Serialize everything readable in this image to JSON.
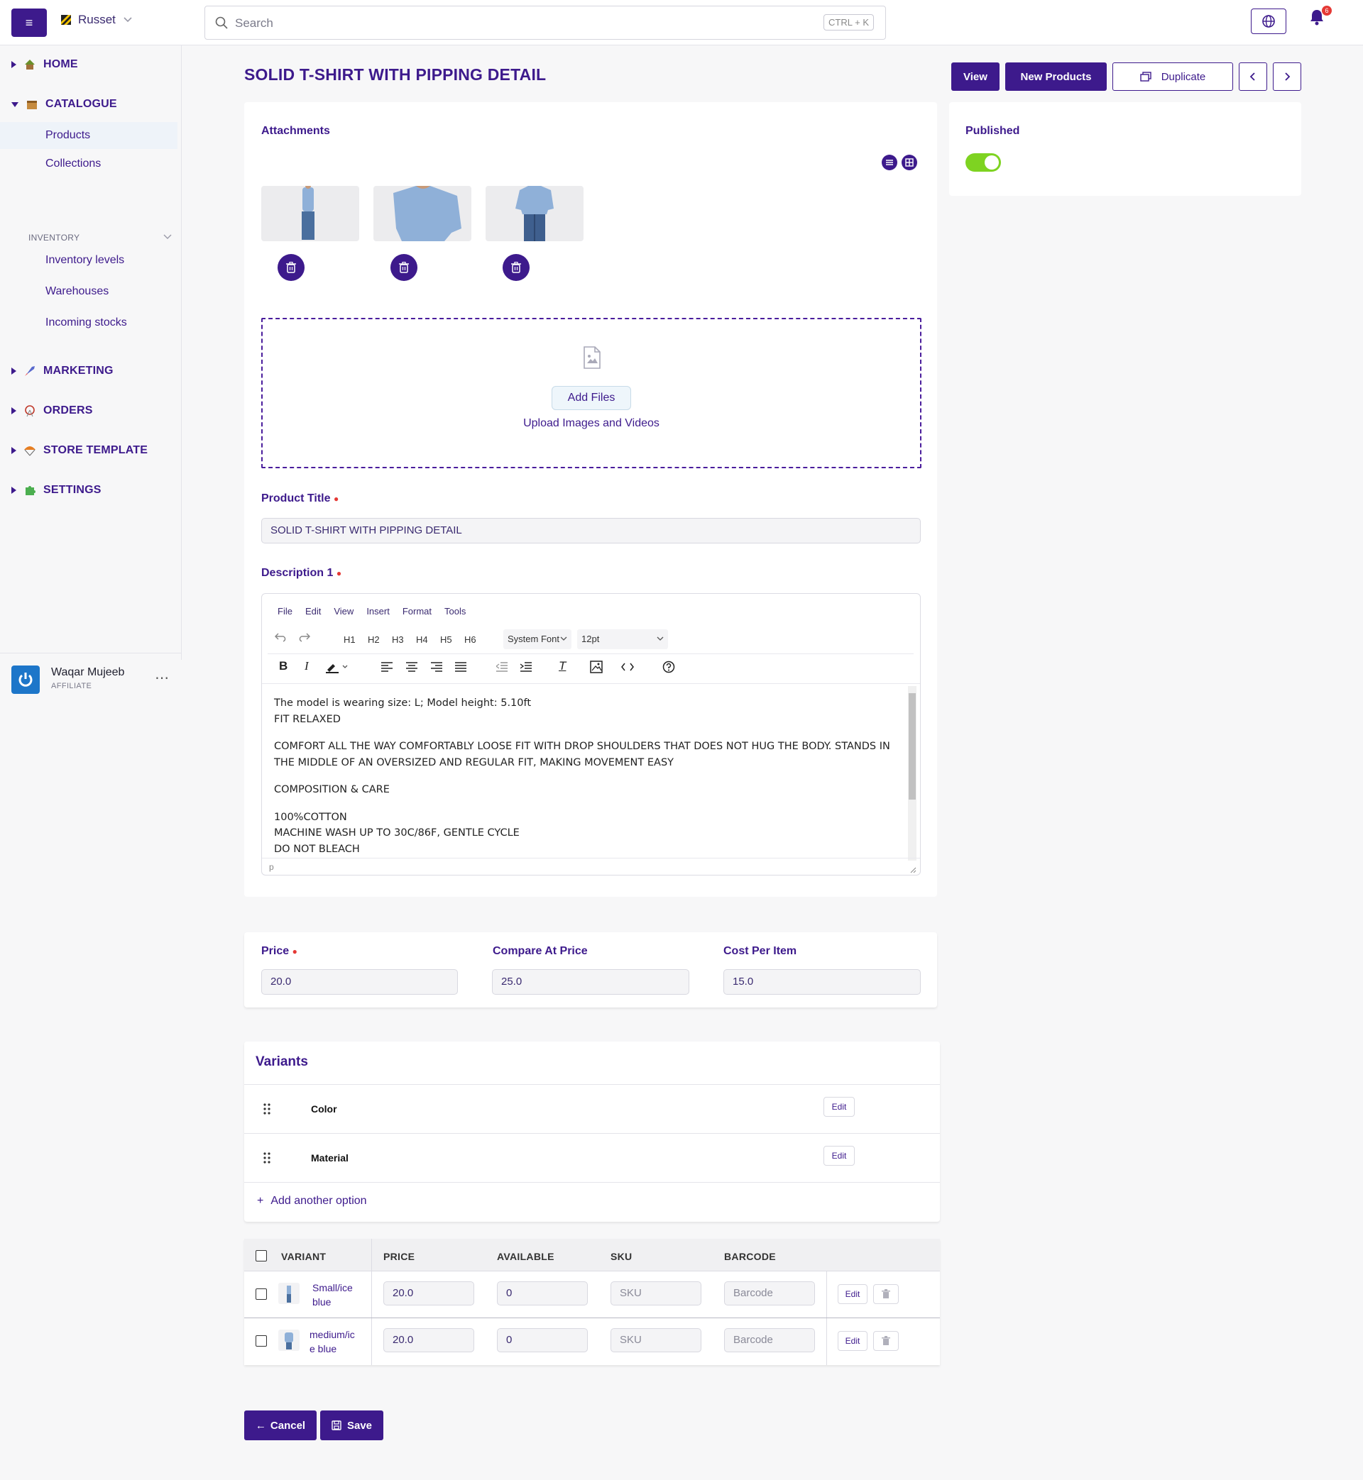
{
  "topbar": {
    "store_name": "Russet",
    "search_placeholder": "Search",
    "search_shortcut": "CTRL + K",
    "notification_count": "6"
  },
  "sidebar": {
    "home": "HOME",
    "catalogue": "CATALOGUE",
    "products": "Products",
    "collections": "Collections",
    "inventory_section": "INVENTORY",
    "inventory_levels": "Inventory levels",
    "warehouses": "Warehouses",
    "incoming_stocks": "Incoming stocks",
    "marketing": "MARKETING",
    "orders": "ORDERS",
    "store_template": "STORE TEMPLATE",
    "settings": "SETTINGS",
    "user_name": "Waqar Mujeeb",
    "user_role": "AFFILIATE"
  },
  "page": {
    "title": "SOLID T-SHIRT WITH PIPPING DETAIL",
    "view_button": "View",
    "new_products_button": "New Products",
    "duplicate_button": "Duplicate"
  },
  "attachments": {
    "heading": "Attachments",
    "add_files": "Add Files",
    "upload_hint": "Upload Images and Videos"
  },
  "product": {
    "title_label": "Product Title",
    "title_value": "SOLID T-SHIRT WITH PIPPING DETAIL",
    "description_label": "Description 1"
  },
  "editor": {
    "menu": [
      "File",
      "Edit",
      "View",
      "Insert",
      "Format",
      "Tools"
    ],
    "headings": [
      "H1",
      "H2",
      "H3",
      "H4",
      "H5",
      "H6"
    ],
    "font": "System Font",
    "size": "12pt",
    "status_path": "p",
    "lines": {
      "l1": "The model is wearing size: L; Model height: 5.10ft",
      "l2": "FIT RELAXED",
      "l3": "COMFORT ALL THE WAY COMFORTABLY LOOSE FIT WITH DROP SHOULDERS THAT DOES NOT HUG THE BODY. STANDS IN THE MIDDLE OF AN OVERSIZED AND REGULAR FIT, MAKING MOVEMENT EASY",
      "l4": "COMPOSITION & CARE",
      "l5": "100%COTTON",
      "l6": "MACHINE WASH UP TO 30C/86F, GENTLE CYCLE",
      "l7": "DO NOT BLEACH"
    }
  },
  "publish": {
    "label": "Published",
    "on": true
  },
  "pricing": {
    "price_label": "Price",
    "price_value": "20.0",
    "compare_label": "Compare At Price",
    "compare_value": "25.0",
    "cost_label": "Cost Per Item",
    "cost_value": "15.0"
  },
  "variants": {
    "heading": "Variants",
    "options": [
      "Color",
      "Material"
    ],
    "edit_label": "Edit",
    "add_option": "Add another option",
    "columns": [
      "VARIANT",
      "PRICE",
      "AVAILABLE",
      "SKU",
      "BARCODE"
    ],
    "rows": [
      {
        "name_1": "Small/ice",
        "name_2": "blue",
        "price": "20.0",
        "available": "0",
        "sku_placeholder": "SKU",
        "barcode_placeholder": "Barcode"
      },
      {
        "name_1": "medium/ic",
        "name_2": "e blue",
        "price": "20.0",
        "available": "0",
        "sku_placeholder": "SKU",
        "barcode_placeholder": "Barcode"
      }
    ]
  },
  "footer": {
    "cancel": "Cancel",
    "save": "Save"
  },
  "colors": {
    "brand": "#3d1a8c",
    "toggle": "#7ed321",
    "danger": "#e53935"
  }
}
